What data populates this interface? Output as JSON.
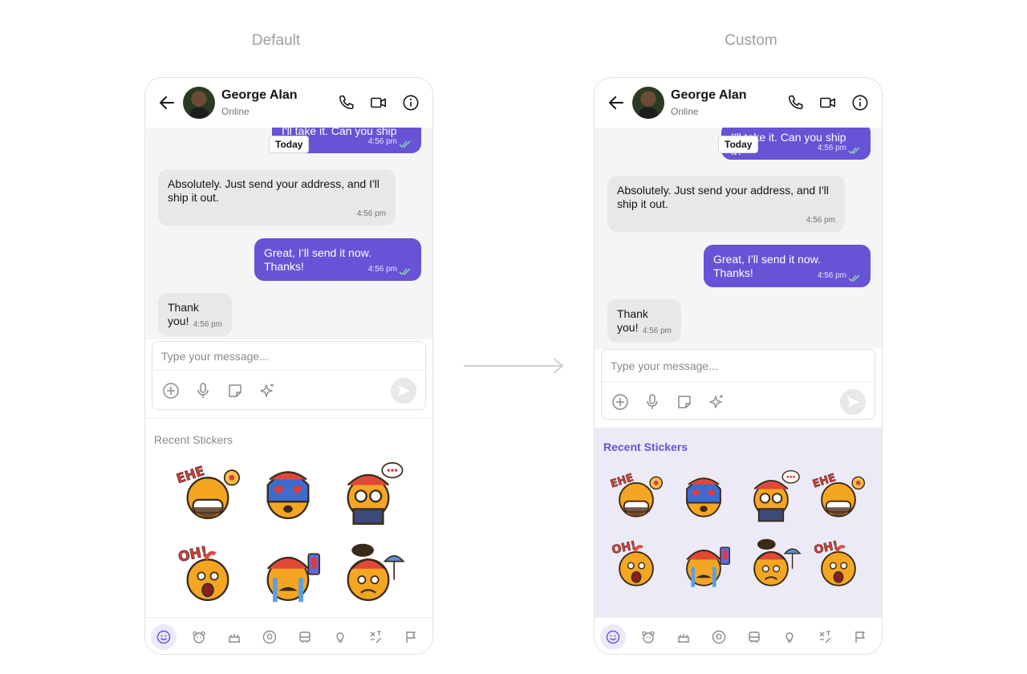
{
  "labels": {
    "default": "Default",
    "custom": "Custom"
  },
  "header": {
    "name": "George Alan",
    "status": "Online"
  },
  "messages": {
    "partial_out": "I'll take it. Can you ship it?",
    "partial_time": "4:56 pm",
    "date_separator": "Today",
    "m1_text": "Absolutely. Just send your address, and I'll ship it out.",
    "m1_time": "4:56 pm",
    "m2_text": "Great, I’ll send it now. Thanks!",
    "m2_time": "4:56 pm",
    "m3_text": "Thank you!",
    "m3_time": "4:56 pm"
  },
  "composer": {
    "placeholder": "Type your message..."
  },
  "stickers": {
    "title": "Recent Stickers",
    "default_order": [
      "ehe-sticker",
      "heart-eyes-sticker",
      "reading-sticker",
      "oh-sticker",
      "crying-phone-sticker",
      "rain-cloud-sticker"
    ],
    "custom_order": [
      "ehe-sticker",
      "heart-eyes-sticker",
      "reading-sticker",
      "ehe-sticker",
      "oh-sticker",
      "crying-phone-sticker",
      "rain-cloud-sticker",
      "oh-sticker"
    ]
  },
  "tabs": [
    "smiley-icon",
    "animal-icon",
    "food-icon",
    "ball-icon",
    "travel-icon",
    "bulb-icon",
    "symbols-icon",
    "flag-icon"
  ],
  "colors": {
    "accent": "#6852d6",
    "custom_sticker_bg": "#edeaf7",
    "custom_title": "#6852d6",
    "default_title": "#8a8a8a",
    "active_tab_bg": "#ece9fb"
  }
}
